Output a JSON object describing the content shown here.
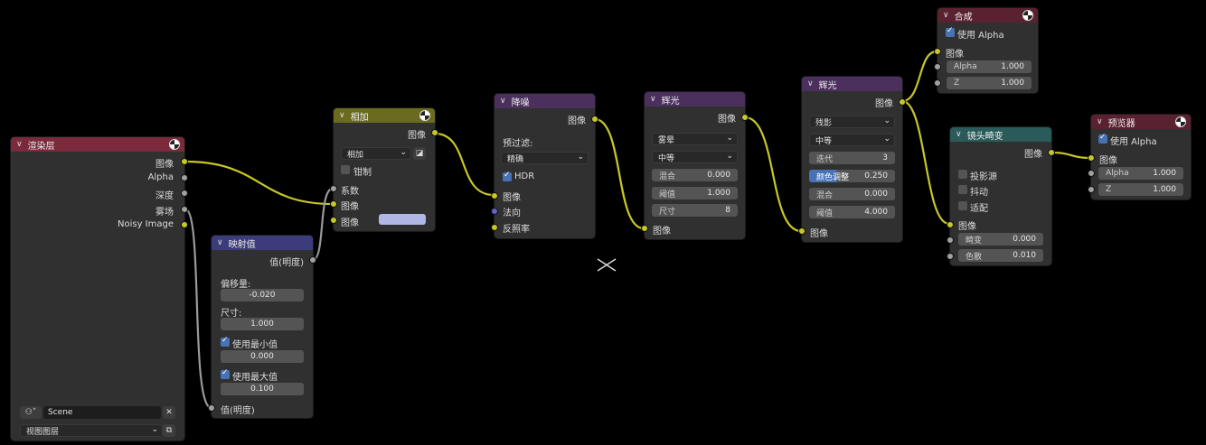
{
  "render_layers": {
    "title": "渲染层",
    "outputs": [
      "图像",
      "Alpha",
      "深度",
      "雾场",
      "Noisy Image"
    ],
    "scene": "Scene",
    "view_layer": "视图图层"
  },
  "map_value": {
    "title": "映射值",
    "output": "值(明度)",
    "offset_label": "偏移量:",
    "offset": "-0.020",
    "size_label": "尺寸:",
    "size": "1.000",
    "use_min_label": "使用最小值",
    "min": "0.000",
    "use_max_label": "使用最大值",
    "max": "0.100",
    "input": "值(明度)"
  },
  "add": {
    "title": "相加",
    "output": "图像",
    "mode": "相加",
    "clamp_label": "钳制",
    "inputs": [
      "系数",
      "图像",
      "图像"
    ]
  },
  "denoise": {
    "title": "降噪",
    "output": "图像",
    "prefilter_label": "预过滤:",
    "prefilter": "精确",
    "hdr_label": "HDR",
    "inputs": [
      "图像",
      "法向",
      "反照率"
    ]
  },
  "glare1": {
    "title": "辉光",
    "output": "图像",
    "type": "雾晕",
    "quality": "中等",
    "fields": [
      {
        "label": "混合",
        "value": "0.000"
      },
      {
        "label": "阈值",
        "value": "1.000"
      },
      {
        "label": "尺寸",
        "value": "8"
      }
    ],
    "input": "图像"
  },
  "glare2": {
    "title": "辉光",
    "output": "图像",
    "type": "残影",
    "quality": "中等",
    "fields": [
      {
        "label": "迭代",
        "value": "3"
      },
      {
        "label": "颜色调整",
        "value": "0.250"
      },
      {
        "label": "混合",
        "value": "0.000"
      },
      {
        "label": "阈值",
        "value": "4.000"
      }
    ],
    "input": "图像"
  },
  "composite": {
    "title": "合成",
    "use_alpha_label": "使用 Alpha",
    "input": "图像",
    "fields": [
      {
        "label": "Alpha",
        "value": "1.000"
      },
      {
        "label": "Z",
        "value": "1.000"
      }
    ]
  },
  "lens": {
    "title": "镜头畸变",
    "output": "图像",
    "projector_label": "投影源",
    "jitter_label": "抖动",
    "fit_label": "适配",
    "input": "图像",
    "fields": [
      {
        "label": "畸变",
        "value": "0.000"
      },
      {
        "label": "色散",
        "value": "0.010"
      }
    ]
  },
  "viewer": {
    "title": "预览器",
    "use_alpha_label": "使用 Alpha",
    "input": "图像",
    "fields": [
      {
        "label": "Alpha",
        "value": "1.000"
      },
      {
        "label": "Z",
        "value": "1.000"
      }
    ]
  },
  "colors": {
    "wire_yellow": "#c7c729",
    "wire_gray": "#9a9a9a",
    "node_body": "#303030"
  }
}
